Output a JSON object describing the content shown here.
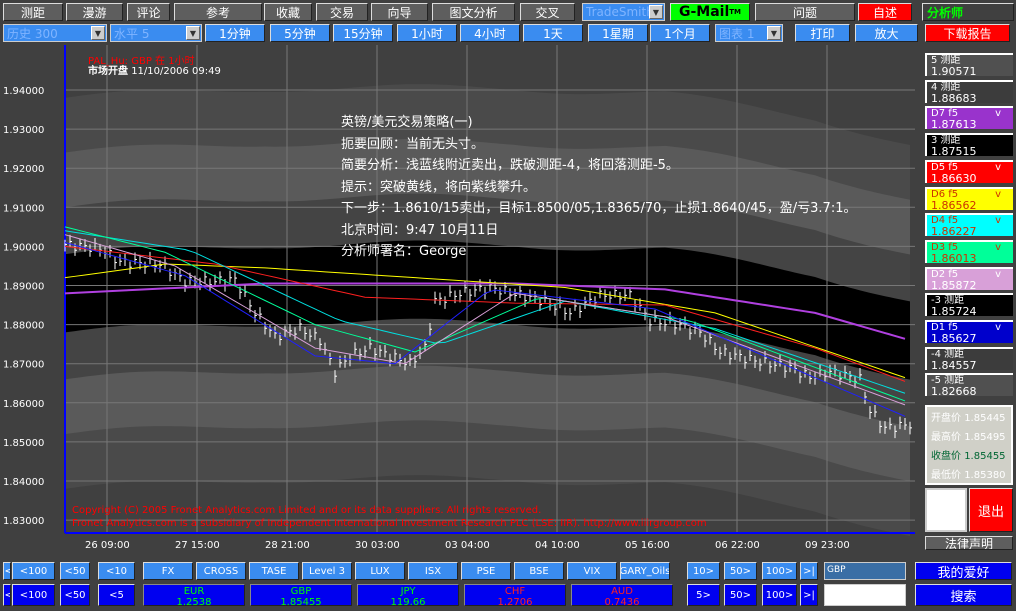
{
  "toolbar1": [
    {
      "label": "测距"
    },
    {
      "label": "漫游"
    },
    {
      "label": "评论"
    },
    {
      "label": "参考"
    },
    {
      "label": "收藏"
    },
    {
      "label": "交易"
    },
    {
      "label": "向导"
    },
    {
      "label": "图文分析"
    },
    {
      "label": "交叉"
    }
  ],
  "provider_select": "TradeSmith",
  "gmail": "G-Mail",
  "gmail_tm": "TM",
  "question": "问题",
  "readme": "自述",
  "analyst": "分析师",
  "history_select": "历史 300",
  "level_select": "水平 5",
  "timeframes": [
    "1分钟",
    "5分钟",
    "15分钟",
    "1小时",
    "4小时",
    "1天",
    "1星期",
    "1个月"
  ],
  "chart_select": "图表 1",
  "print": "打印",
  "zoom": "放大",
  "download_report": "下载报告",
  "chart_header": {
    "title": "PAL_Hu: GBP 在 1小时",
    "market_open_label": "市场开盘",
    "datetime": "11/10/2006 09:49"
  },
  "commentary": [
    "英镑/美元交易策略(一)",
    "扼要回顾：当前无头寸。",
    "简要分析：浅蓝线附近卖出，跌破测距-4，将回落测距-5。",
    "提示：突破黄线，将向紫线攀升。",
    "下一步：1.8610/15卖出，目标1.8500/05,1.8365/70，止损1.8640/45，盈/亏3.7:1。",
    "北京时间：9:47    10月11日",
    "分析师署名：George"
  ],
  "copyright": [
    "Copyright (C) 2005 Fronet Analytics.com Limited and or its data suppliers.  All rights reserved.",
    "Fronet Analytics.com is a subsidiary of Independent International Investment Research PLC (LSE: IIR).  http://www.iiirgroup.com"
  ],
  "levels": [
    {
      "name": "5 测距",
      "value": "1.90571",
      "bg": "#505050",
      "fg": "#ffffff",
      "v": ""
    },
    {
      "name": "4 测距",
      "value": "1.88683",
      "bg": "#3c3c3c",
      "fg": "#ffffff",
      "v": ""
    },
    {
      "name": "D7  f5",
      "value": "1.87613",
      "bg": "#9933cc",
      "fg": "#ffffff",
      "v": "v"
    },
    {
      "name": "3 测距",
      "value": "1.87515",
      "bg": "#000000",
      "fg": "#ffffff",
      "v": ""
    },
    {
      "name": "D5  f5",
      "value": "1.86630",
      "bg": "#ff0000",
      "fg": "#ffffff",
      "v": "v"
    },
    {
      "name": "D6  f5",
      "value": "1.86562",
      "bg": "#ffff00",
      "fg": "#cc3300",
      "v": "v"
    },
    {
      "name": "D4  f5",
      "value": "1.86227",
      "bg": "#00ffff",
      "fg": "#cc3300",
      "v": "v"
    },
    {
      "name": "D3  f5",
      "value": "1.86013",
      "bg": "#00ff99",
      "fg": "#cc3300",
      "v": "v"
    },
    {
      "name": "D2  f5",
      "value": "1.85872",
      "bg": "#d8a0d8",
      "fg": "#ffffff",
      "v": "v"
    },
    {
      "name": "-3 测距",
      "value": "1.85724",
      "bg": "#000000",
      "fg": "#ffffff",
      "v": ""
    },
    {
      "name": "D1  f5",
      "value": "1.85627",
      "bg": "#0000cc",
      "fg": "#ffffff",
      "v": "v"
    },
    {
      "name": "-4 测距",
      "value": "1.84557",
      "bg": "#3c3c3c",
      "fg": "#ffffff",
      "v": ""
    },
    {
      "name": "-5 测距",
      "value": "1.82668",
      "bg": "#505050",
      "fg": "#ffffff",
      "v": ""
    }
  ],
  "ohlc": [
    {
      "label": "开盘价",
      "value": "1.85445",
      "color": "#ffffff"
    },
    {
      "label": "最高价",
      "value": "1.85495",
      "color": "#ffffff"
    },
    {
      "label": "收盘价",
      "value": "1.85455",
      "color": "#006633"
    },
    {
      "label": "最低价",
      "value": "1.85380",
      "color": "#ffffff"
    }
  ],
  "exit": "退出",
  "legal": "法律声明",
  "nav_row1_left": [
    "|<",
    "<100",
    "<50",
    "<10"
  ],
  "nav_row2_left": [
    "|<",
    "<100",
    "<50",
    "<5"
  ],
  "markets": [
    "FX",
    "CROSS",
    "TASE",
    "Level 3",
    "LUX",
    "ISX",
    "PSE",
    "BSE",
    "VIX",
    "GARY_Oils"
  ],
  "quotes": [
    {
      "sym": "EUR",
      "val": "1.2538",
      "color": "#00ff00"
    },
    {
      "sym": "GBP",
      "val": "1.85455",
      "color": "#00ff00"
    },
    {
      "sym": "JPY",
      "val": "119.66",
      "color": "#00ff00"
    },
    {
      "sym": "CHF",
      "val": "1.2706",
      "color": "#ff2020"
    },
    {
      "sym": "AUD",
      "val": "0.7436",
      "color": "#ff2020"
    }
  ],
  "nav_row1_right": [
    "10>",
    "50>",
    "100>",
    ">|"
  ],
  "nav_row2_right": [
    "5>",
    "50>",
    "100>",
    ">|"
  ],
  "symbol_input": "GBP",
  "search_input": "",
  "favorites": "我的爱好",
  "search": "搜索",
  "chart_data": {
    "type": "line",
    "title": "PAL_Hu: GBP 在 1小时",
    "ylim": [
      1.825,
      1.947
    ],
    "yticks": [
      "1.94000",
      "1.93000",
      "1.92000",
      "1.91000",
      "1.90000",
      "1.89000",
      "1.88000",
      "1.87000",
      "1.86000",
      "1.85000",
      "1.84000",
      "1.83000"
    ],
    "xticks": [
      {
        "bar": 5,
        "label": "26 09:00"
      },
      {
        "bar": 23,
        "label": "27 15:00"
      },
      {
        "bar": 41,
        "label": "28 21:00"
      },
      {
        "bar": 59,
        "label": "30 03:00"
      },
      {
        "bar": 77,
        "label": "03 04:00"
      },
      {
        "bar": 95,
        "label": "04 10:00"
      },
      {
        "bar": 113,
        "label": "05 16:00"
      },
      {
        "bar": 131,
        "label": "06 22:00"
      },
      {
        "bar": 149,
        "label": "09 23:00"
      }
    ],
    "bars": 170,
    "price_keypoints": [
      [
        0,
        1.9005
      ],
      [
        7,
        1.8995
      ],
      [
        11,
        1.896
      ],
      [
        19,
        1.8955
      ],
      [
        24,
        1.891
      ],
      [
        29,
        1.891
      ],
      [
        34,
        1.8915
      ],
      [
        38,
        1.883
      ],
      [
        42,
        1.877
      ],
      [
        47,
        1.879
      ],
      [
        51,
        1.876
      ],
      [
        54,
        1.868
      ],
      [
        57,
        1.872
      ],
      [
        61,
        1.874
      ],
      [
        65,
        1.872
      ],
      [
        69,
        1.87
      ],
      [
        72,
        1.874
      ],
      [
        74,
        1.886
      ],
      [
        79,
        1.888
      ],
      [
        85,
        1.8895
      ],
      [
        91,
        1.8875
      ],
      [
        96,
        1.886
      ],
      [
        101,
        1.883
      ],
      [
        107,
        1.8875
      ],
      [
        113,
        1.8875
      ],
      [
        117,
        1.881
      ],
      [
        123,
        1.88
      ],
      [
        127,
        1.878
      ],
      [
        131,
        1.873
      ],
      [
        139,
        1.8705
      ],
      [
        145,
        1.869
      ],
      [
        149,
        1.8665
      ],
      [
        153,
        1.868
      ],
      [
        159,
        1.866
      ],
      [
        161,
        1.858
      ],
      [
        164,
        1.8535
      ],
      [
        169,
        1.8545
      ]
    ],
    "series": [
      {
        "name": "D7",
        "color": "#b040e0",
        "points": [
          [
            0,
            1.888
          ],
          [
            40,
            1.8905
          ],
          [
            90,
            1.8905
          ],
          [
            120,
            1.889
          ],
          [
            150,
            1.883
          ],
          [
            169,
            1.876
          ]
        ]
      },
      {
        "name": "D6",
        "color": "#ffff00",
        "points": [
          [
            0,
            1.892
          ],
          [
            20,
            1.8955
          ],
          [
            40,
            1.8945
          ],
          [
            70,
            1.892
          ],
          [
            100,
            1.8895
          ],
          [
            130,
            1.883
          ],
          [
            169,
            1.866
          ]
        ]
      },
      {
        "name": "D5",
        "color": "#ff2020",
        "points": [
          [
            0,
            1.9
          ],
          [
            30,
            1.8955
          ],
          [
            60,
            1.887
          ],
          [
            90,
            1.8855
          ],
          [
            120,
            1.885
          ],
          [
            150,
            1.874
          ],
          [
            169,
            1.865
          ]
        ]
      },
      {
        "name": "D4",
        "color": "#00e0e0",
        "points": [
          [
            0,
            1.904
          ],
          [
            25,
            1.899
          ],
          [
            55,
            1.881
          ],
          [
            75,
            1.875
          ],
          [
            100,
            1.886
          ],
          [
            130,
            1.879
          ],
          [
            169,
            1.862
          ]
        ]
      },
      {
        "name": "D3",
        "color": "#00ff99",
        "points": [
          [
            0,
            1.905
          ],
          [
            20,
            1.8985
          ],
          [
            50,
            1.88
          ],
          [
            70,
            1.873
          ],
          [
            95,
            1.887
          ],
          [
            125,
            1.881
          ],
          [
            169,
            1.86
          ]
        ]
      },
      {
        "name": "D2",
        "color": "#d8a0d8",
        "points": [
          [
            0,
            1.903
          ],
          [
            22,
            1.895
          ],
          [
            50,
            1.874
          ],
          [
            68,
            1.87
          ],
          [
            90,
            1.888
          ],
          [
            120,
            1.882
          ],
          [
            169,
            1.859
          ]
        ]
      },
      {
        "name": "D1",
        "color": "#2020ff",
        "points": [
          [
            0,
            1.901
          ],
          [
            24,
            1.8925
          ],
          [
            50,
            1.872
          ],
          [
            66,
            1.87
          ],
          [
            85,
            1.889
          ],
          [
            118,
            1.884
          ],
          [
            169,
            1.856
          ]
        ]
      }
    ]
  }
}
